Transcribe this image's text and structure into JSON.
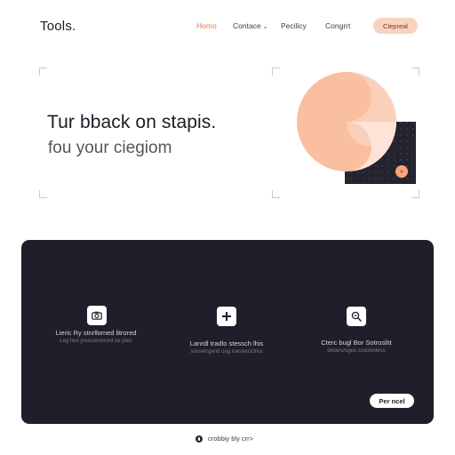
{
  "header": {
    "logo": "Tools.",
    "nav": [
      {
        "label": "Homo",
        "active": true
      },
      {
        "label": "Contace",
        "dropdown": true
      },
      {
        "label": "Pecilicy"
      },
      {
        "label": "Congrrt"
      }
    ],
    "cta_label": "Clepreal"
  },
  "hero": {
    "title": "Tur bback on stapis.",
    "subtitle": "fou your ciegiom",
    "accent_color": "#f9bf9e",
    "dark_color": "#23242f"
  },
  "features": [
    {
      "icon": "camera-icon",
      "title": "Lieric Ry stnrllomed litrored",
      "desc": "Leg hes yousserrerord oe ptes"
    },
    {
      "icon": "plus-icon",
      "title": "Lanrdl tradlo stessch lhis",
      "desc": "sosserrgend oug toesteroctres"
    },
    {
      "icon": "search-icon",
      "title": "Cterc bugl Bor Sotroslitt",
      "desc": "deserv/oges sostrerdess"
    }
  ],
  "panel": {
    "button_label": "Per ncel",
    "background_color": "#1e1f2a"
  },
  "footer": {
    "text": "crobbiy bly crr>"
  }
}
